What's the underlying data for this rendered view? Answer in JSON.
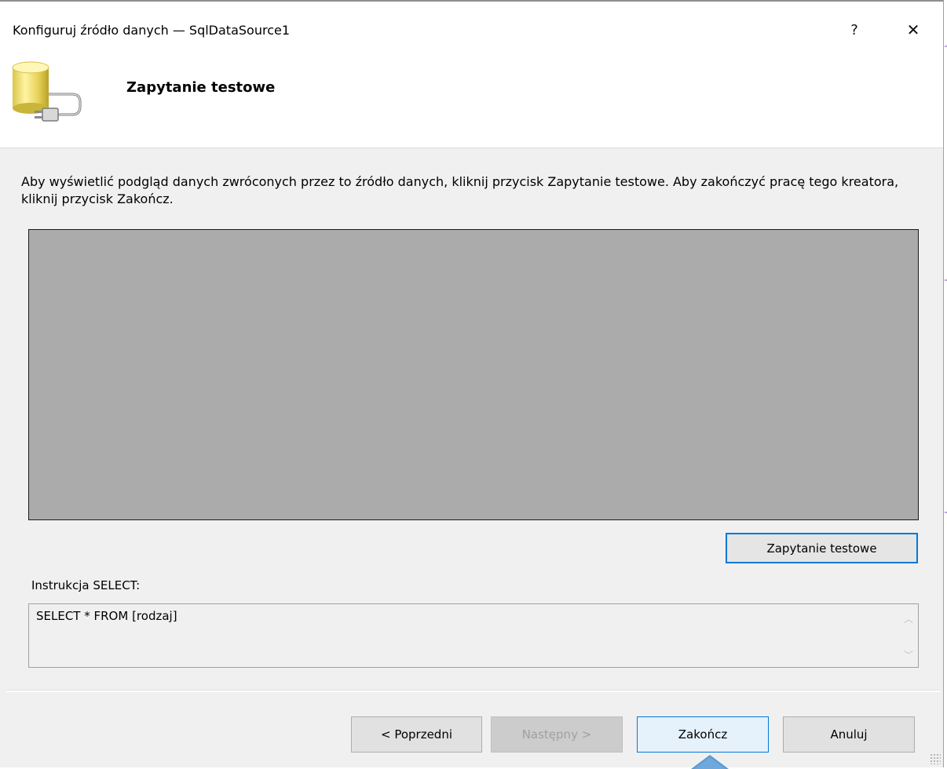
{
  "window": {
    "title": "Konfiguruj źródło danych — SqlDataSource1",
    "help_label": "?",
    "close_label": "✕"
  },
  "header": {
    "title": "Zapytanie testowe",
    "icon": "database-plug-icon"
  },
  "description": "Aby wyświetlić podgląd danych zwróconych przez to źródło danych, kliknij przycisk Zapytanie testowe. Aby zakończyć pracę tego kreatora, kliknij przycisk Zakończ.",
  "test_query_button": "Zapytanie testowe",
  "select": {
    "label": "Instrukcja SELECT:",
    "statement": "SELECT * FROM [rodzaj]",
    "scroll_up": "︿",
    "scroll_down": "﹀"
  },
  "footer": {
    "prev_label": "< Poprzedni",
    "next_label": "Następny >",
    "finish_label": "Zakończ",
    "cancel_label": "Anuluj"
  },
  "colors": {
    "accent": "#0078d7",
    "preview_bg": "#ababab",
    "dialog_bg": "#f0f0f0"
  }
}
